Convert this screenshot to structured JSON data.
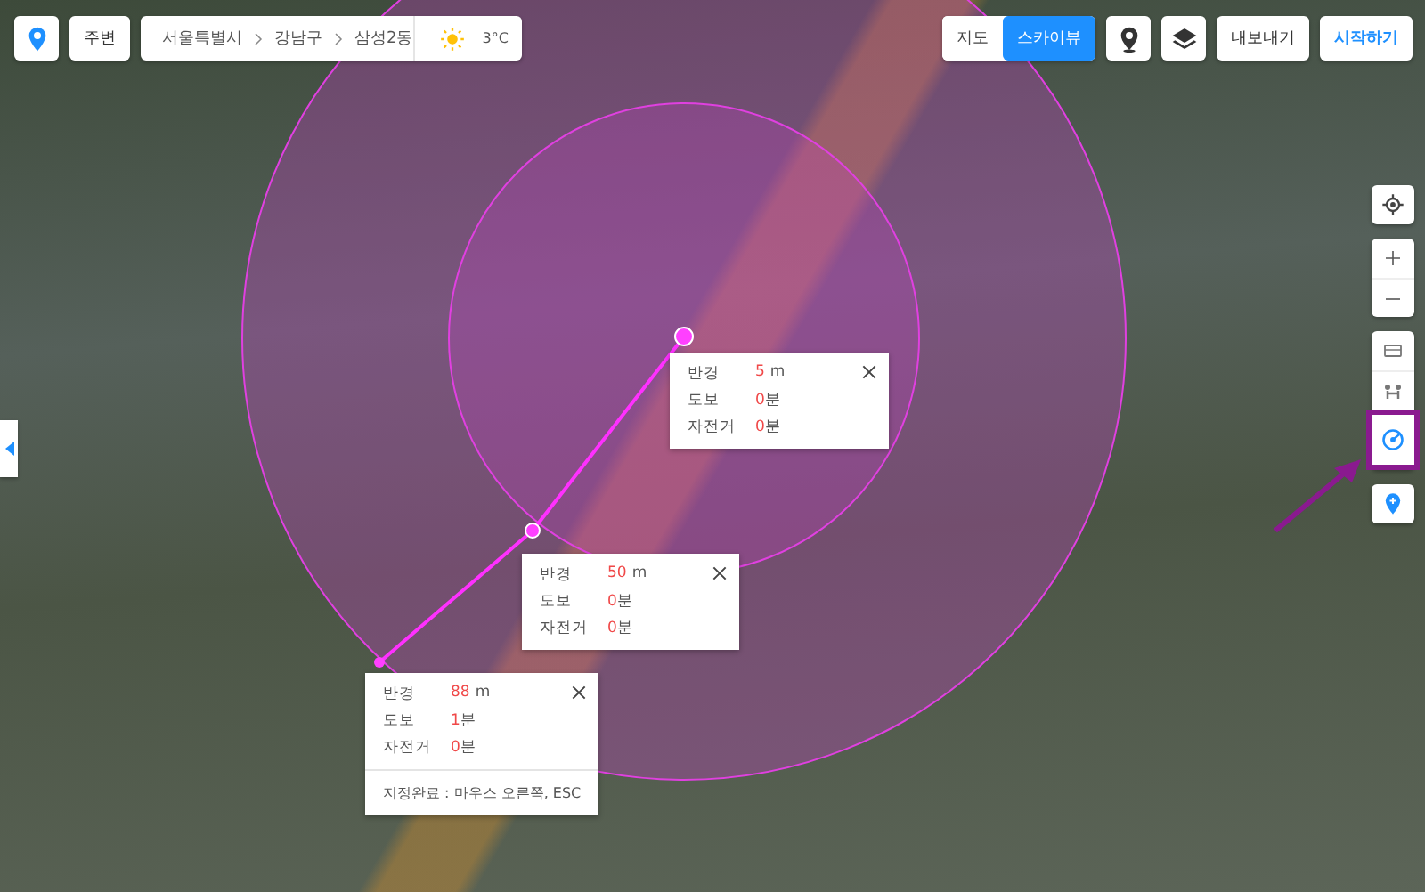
{
  "top_left": {
    "nearby_button": "주변",
    "breadcrumb": [
      "서울특별시",
      "강남구",
      "삼성2동"
    ],
    "weather": {
      "temperature": "3°C"
    }
  },
  "map_type": [
    {
      "label": "지도",
      "selected": false
    },
    {
      "label": "스카이뷰",
      "selected": true
    }
  ],
  "top_right": {
    "export_button": "내보내기",
    "start_button": "시작하기"
  },
  "right_tools": [
    {
      "kind": "ruler",
      "selected": false
    },
    {
      "kind": "street",
      "selected": false
    },
    {
      "kind": "radius",
      "selected": true
    }
  ],
  "radius_popups": [
    {
      "rows": [
        {
          "label": "반경",
          "value": "5",
          "unit": "m"
        },
        {
          "label": "도보",
          "value": "0",
          "unit": "분"
        },
        {
          "label": "자전거",
          "value": "0",
          "unit": "분"
        }
      ]
    },
    {
      "rows": [
        {
          "label": "반경",
          "value": "50",
          "unit": "m"
        },
        {
          "label": "도보",
          "value": "0",
          "unit": "분"
        },
        {
          "label": "자전거",
          "value": "0",
          "unit": "분"
        }
      ]
    },
    {
      "rows": [
        {
          "label": "반경",
          "value": "88",
          "unit": "m"
        },
        {
          "label": "도보",
          "value": "1",
          "unit": "분"
        },
        {
          "label": "자전거",
          "value": "0",
          "unit": "분"
        }
      ],
      "footer": "지정완료 : 마우스 오른쪽, ESC"
    }
  ]
}
